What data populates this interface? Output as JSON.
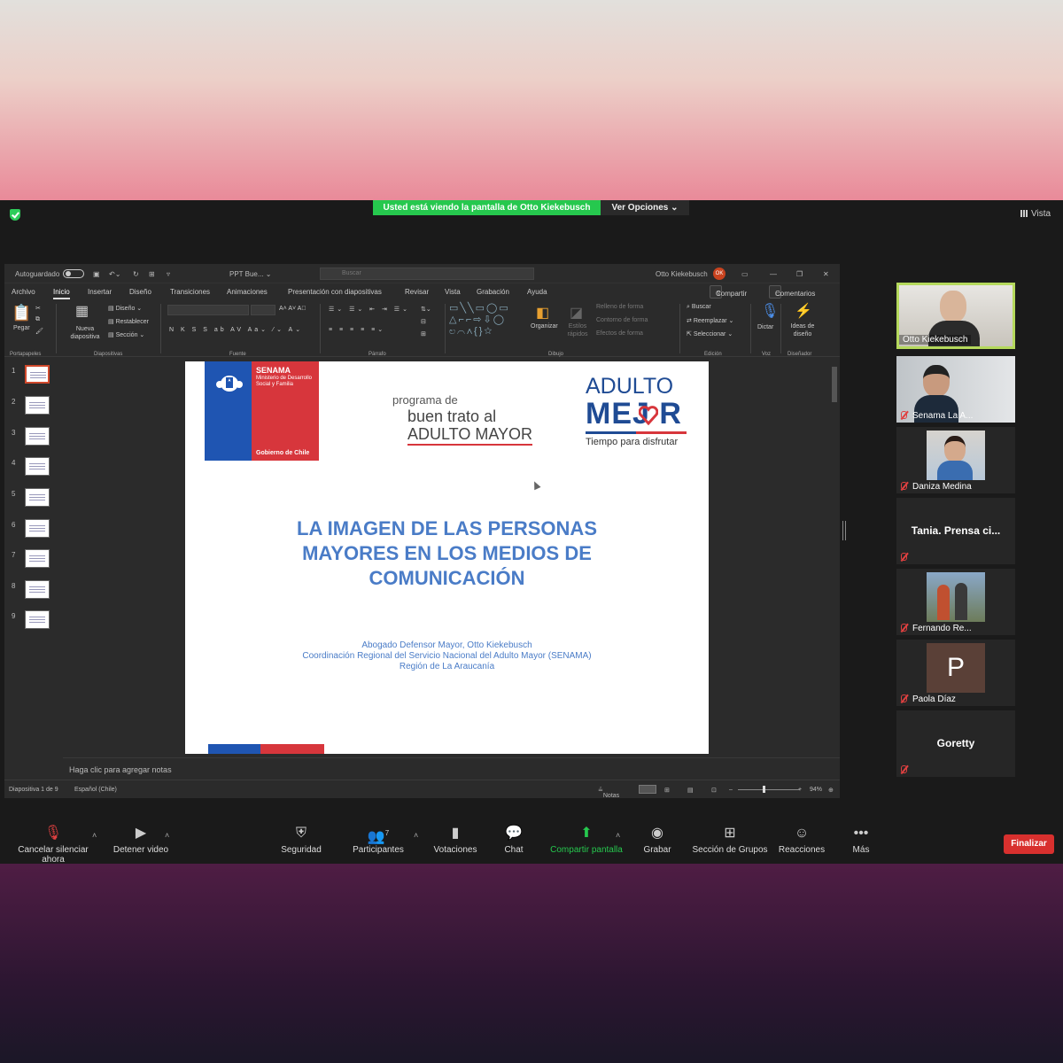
{
  "zoom": {
    "share_banner": "Usted está viendo la pantalla de Otto Kiekebusch",
    "view_options": "Ver Opciones",
    "view_label": "Vista",
    "end_button": "Finalizar",
    "participants_count": "7",
    "toolbar": [
      {
        "label": "Cancelar silenciar ahora",
        "icon": "mic-muted-icon"
      },
      {
        "label": "Detener video",
        "icon": "video-camera-icon"
      },
      {
        "label": "Seguridad",
        "icon": "shield-icon"
      },
      {
        "label": "Participantes",
        "icon": "participants-icon"
      },
      {
        "label": "Votaciones",
        "icon": "poll-icon"
      },
      {
        "label": "Chat",
        "icon": "chat-icon"
      },
      {
        "label": "Compartir pantalla",
        "icon": "share-screen-icon"
      },
      {
        "label": "Grabar",
        "icon": "record-icon"
      },
      {
        "label": "Sección de Grupos",
        "icon": "breakout-rooms-icon"
      },
      {
        "label": "Reacciones",
        "icon": "reactions-icon"
      },
      {
        "label": "Más",
        "icon": "more-icon"
      }
    ],
    "participants": [
      {
        "name": "Otto Kiekebusch",
        "active_speaker": true
      },
      {
        "name": "Senama La A...",
        "muted": true
      },
      {
        "name": "Daniza Medina",
        "muted": true
      },
      {
        "name": "Tania. Prensa ci...",
        "muted": true,
        "video": false
      },
      {
        "name": "Fernando Re...",
        "muted": true
      },
      {
        "name": "Paola Díaz",
        "muted": true,
        "initial": "P"
      },
      {
        "name": "Goretty",
        "muted": true,
        "video": false
      }
    ],
    "accent_green": "#26c84e",
    "end_red": "#d8302e",
    "active_speaker_color": "#b5d95c"
  },
  "ppt": {
    "autosave": "Autoguardado",
    "file_name": "PPT Bue...",
    "search_placeholder": "Buscar",
    "user_name": "Otto Kiekebusch",
    "user_initials": "OK",
    "menu": [
      "Archivo",
      "Inicio",
      "Insertar",
      "Diseño",
      "Transiciones",
      "Animaciones",
      "Presentación con diapositivas",
      "Revisar",
      "Vista",
      "Grabación",
      "Ayuda"
    ],
    "share": "Compartir",
    "comments": "Comentarios",
    "ribbon": {
      "paste": "Pegar",
      "new_slide": "Nueva diapositiva",
      "layout": "Diseño",
      "reset": "Restablecer",
      "section": "Sección",
      "arrange": "Organizar",
      "quick_styles": "Estilos rápidos",
      "shape_fill": "Relleno de forma",
      "shape_outline": "Contorno de forma",
      "shape_effects": "Efectos de forma",
      "find": "Buscar",
      "replace": "Reemplazar",
      "select": "Seleccionar",
      "dictate": "Dictar",
      "design_ideas": "Ideas de diseño",
      "groups": [
        "Portapapeles",
        "Diapositivas",
        "Fuente",
        "Párrafo",
        "Dibujo",
        "Edición",
        "Voz",
        "Diseñador"
      ]
    },
    "slide_numbers": [
      "1",
      "2",
      "3",
      "4",
      "5",
      "6",
      "7",
      "8",
      "9"
    ],
    "notes_placeholder": "Haga clic para agregar notas",
    "status": {
      "slide_count": "Diapositiva 1 de 9",
      "language": "Español (Chile)",
      "notes": "Notas",
      "zoom": "94%"
    }
  },
  "slide": {
    "senama": "SENAMA",
    "ministry": "Ministerio de Desarrollo Social y Familia",
    "gobierno": "Gobierno de Chile",
    "program_line1": "programa de",
    "program_line2": "buen trato al",
    "program_line3": "ADULTO MAYOR",
    "am_line1": "ADULTO",
    "am_line2": "MEJ R",
    "am_tagline": "Tiempo para disfrutar",
    "title_lines": [
      "LA IMAGEN DE LAS PERSONAS",
      "MAYORES EN LOS MEDIOS DE",
      "COMUNICACIÓN"
    ],
    "subtitle_lines": [
      "Abogado Defensor Mayor, Otto Kiekebusch",
      "Coordinación Regional del Servicio Nacional del Adulto Mayor (SENAMA)",
      "Región de La Araucanía"
    ]
  }
}
